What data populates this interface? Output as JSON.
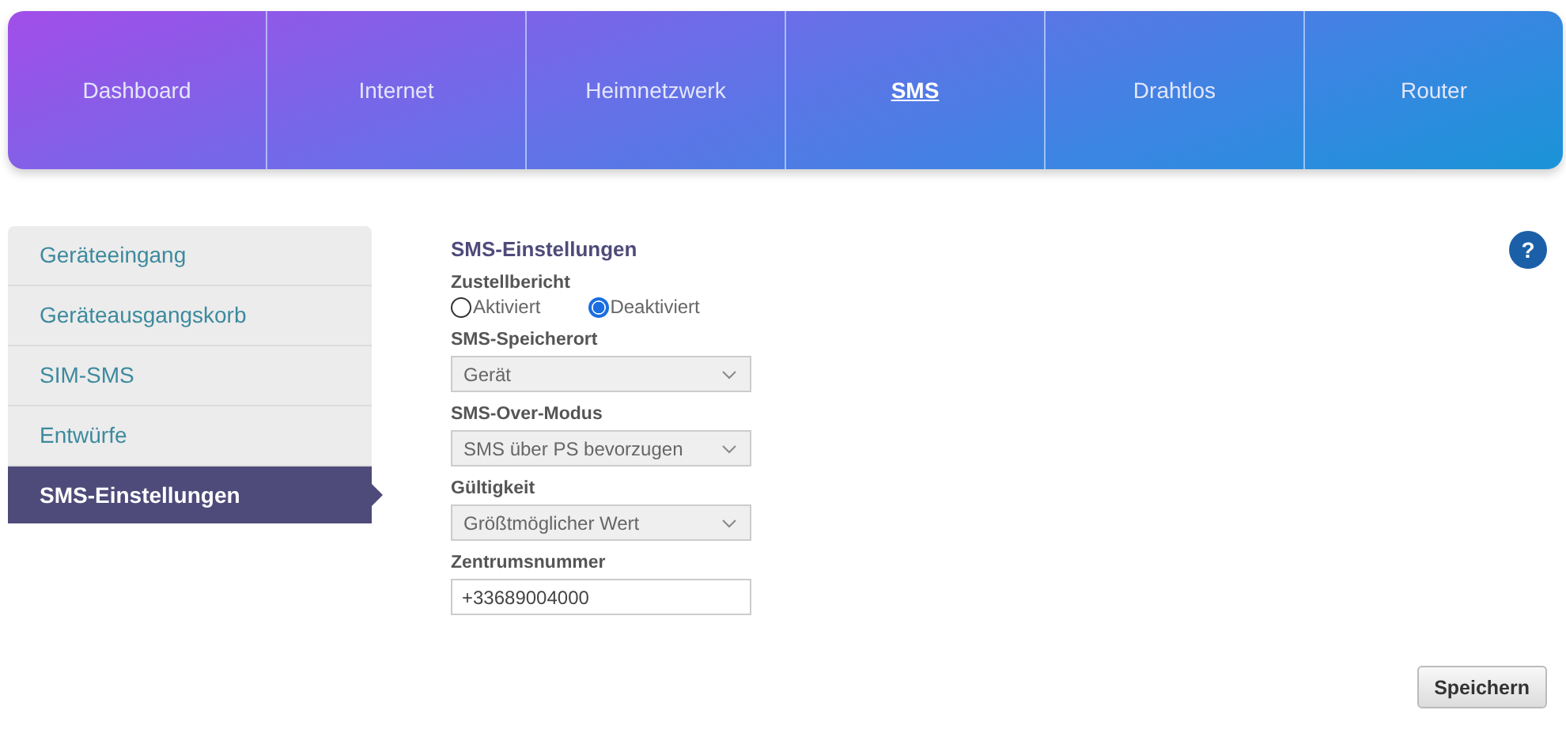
{
  "nav": [
    {
      "label": "Dashboard",
      "selected": false
    },
    {
      "label": "Internet",
      "selected": false
    },
    {
      "label": "Heimnetzwerk",
      "selected": false
    },
    {
      "label": "SMS",
      "selected": true
    },
    {
      "label": "Drahtlos",
      "selected": false
    },
    {
      "label": "Router",
      "selected": false
    }
  ],
  "sidebar": {
    "items": [
      {
        "label": "Geräteeingang",
        "selected": false
      },
      {
        "label": "Geräteausgangskorb",
        "selected": false
      },
      {
        "label": "SIM-SMS",
        "selected": false
      },
      {
        "label": "Entwürfe",
        "selected": false
      },
      {
        "label": "SMS-Einstellungen",
        "selected": true
      }
    ]
  },
  "section_title": "SMS-Einstellungen",
  "help": "?",
  "fields": [
    {
      "kind": "radio",
      "label": "Zustellbericht",
      "options": [
        {
          "label": "Aktiviert",
          "selected": false
        },
        {
          "label": "Deaktiviert",
          "selected": true
        }
      ]
    },
    {
      "kind": "select",
      "label": "SMS-Speicherort",
      "value": "Gerät"
    },
    {
      "kind": "select",
      "label": "SMS-Over-Modus",
      "value": "SMS über PS bevorzugen"
    },
    {
      "kind": "select",
      "label": "Gültigkeit",
      "value": "Größtmöglicher Wert"
    },
    {
      "kind": "text",
      "label": "Zentrumsnummer",
      "value": "+33689004000"
    }
  ],
  "save_button": "Speichern"
}
